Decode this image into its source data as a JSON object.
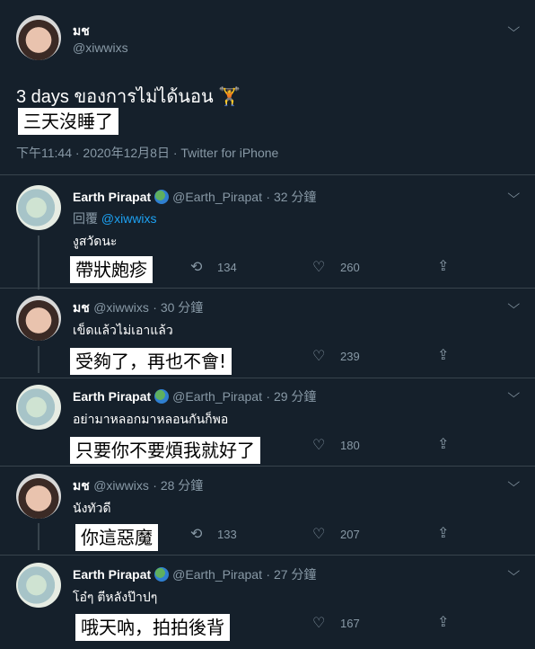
{
  "main": {
    "name": "มช",
    "handle": "@xiwwixs",
    "text": "3 days ของการไม่ได้นอน",
    "emoji": "🏋",
    "subtitle": "三天沒睡了",
    "meta": "下午11:44 · 2020年12月8日 · Twitter for iPhone"
  },
  "replies": [
    {
      "name": "Earth Pirapat",
      "handle": "@Earth_Pirapat",
      "time": "· 32 分鐘",
      "reply_prefix": "回覆",
      "reply_to": "@xiwwixs",
      "text": "งูสวัดนะ",
      "subtitle": "帶狀皰疹",
      "retweets": "134",
      "likes": "260"
    },
    {
      "name": "มช",
      "handle": "@xiwwixs",
      "time": "· 30 分鐘",
      "text": "เข็ดแล้วไม่เอาแล้ว",
      "subtitle": "受夠了，再也不會!",
      "likes": "239"
    },
    {
      "name": "Earth Pirapat",
      "handle": "@Earth_Pirapat",
      "time": "· 29 分鐘",
      "text": "อย่ามาหลอกมาหลอนกันก็พอ",
      "subtitle": "只要你不要煩我就好了",
      "likes": "180"
    },
    {
      "name": "มช",
      "handle": "@xiwwixs",
      "time": "· 28 分鐘",
      "text": "นังทัวดี",
      "subtitle": "你這惡魔",
      "retweets": "133",
      "likes": "207"
    },
    {
      "name": "Earth Pirapat",
      "handle": "@Earth_Pirapat",
      "time": "· 27 分鐘",
      "text": "โอ๋ๆ ตีหลังป๊าปๆ",
      "subtitle": "哦天吶，拍拍後背",
      "likes": "167"
    }
  ],
  "icons": {
    "chevron": "chevron-down-icon",
    "retweet": "retweet-icon",
    "like": "heart-icon",
    "share": "share-icon"
  },
  "colors": {
    "background": "#15202b",
    "muted": "#8899a6",
    "link": "#1da1f2",
    "divider": "#38444d"
  }
}
